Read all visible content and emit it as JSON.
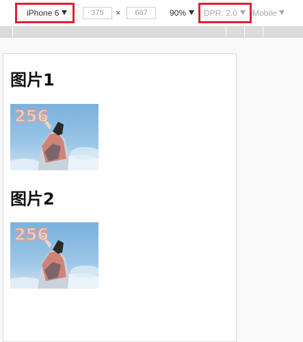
{
  "toolbar": {
    "device": "iPhone 6",
    "width": "375",
    "height": "667",
    "times": "×",
    "zoom": "90%",
    "dpr": "DPR: 2.0",
    "mode": "Mobile"
  },
  "page": {
    "sections": [
      {
        "heading": "图片1",
        "image_text": "256"
      },
      {
        "heading": "图片2",
        "image_text": "256"
      }
    ]
  },
  "colors": {
    "highlight": "#e01e35",
    "sky": "#7fb6df"
  }
}
